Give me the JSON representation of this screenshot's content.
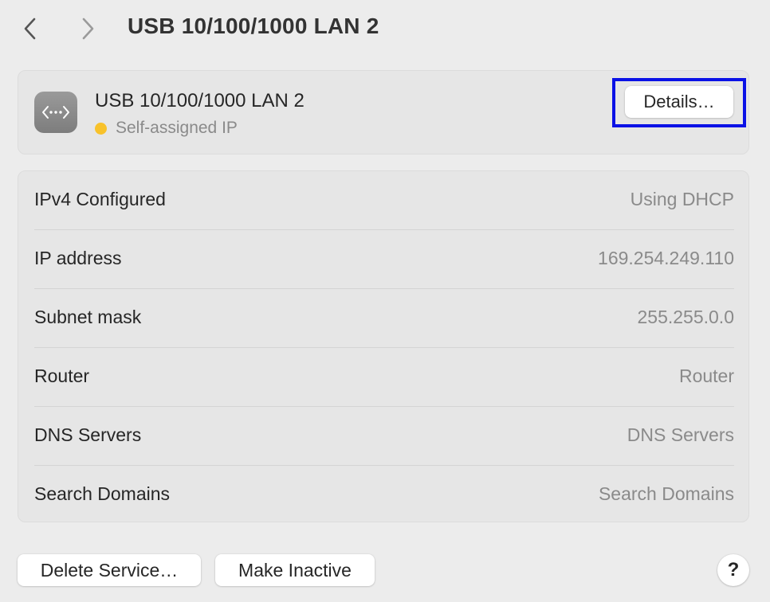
{
  "header": {
    "title": "USB 10/100/1000 LAN 2",
    "back_icon": "chevron-left-icon",
    "forward_icon": "chevron-right-icon"
  },
  "service": {
    "name": "USB 10/100/1000 LAN 2",
    "icon": "ethernet-icon",
    "status": "Self-assigned IP",
    "status_color": "#f8c22b",
    "details_label": "Details…",
    "highlight_color": "#0a11e6"
  },
  "info": {
    "rows": [
      {
        "label": "IPv4 Configured",
        "value": "Using DHCP"
      },
      {
        "label": "IP address",
        "value": "169.254.249.110"
      },
      {
        "label": "Subnet mask",
        "value": "255.255.0.0"
      },
      {
        "label": "Router",
        "value": "Router"
      },
      {
        "label": "DNS Servers",
        "value": "DNS Servers"
      },
      {
        "label": "Search Domains",
        "value": "Search Domains"
      }
    ]
  },
  "footer": {
    "delete_label": "Delete Service…",
    "inactive_label": "Make Inactive",
    "help_label": "?"
  }
}
